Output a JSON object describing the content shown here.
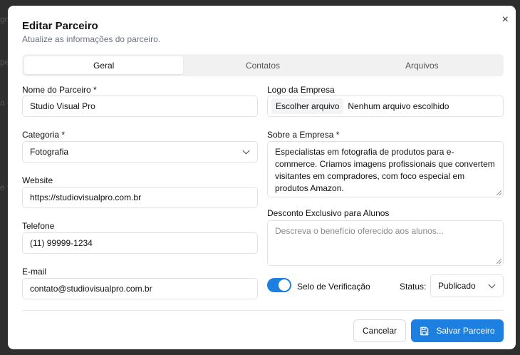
{
  "backdrop": {
    "fragments": [
      "gr",
      "pe",
      "a c",
      "e v"
    ]
  },
  "dialog": {
    "title": "Editar Parceiro",
    "subtitle": "Atualize as informações do parceiro.",
    "close_glyph": "×"
  },
  "tabs": [
    {
      "label": "Geral",
      "active": true
    },
    {
      "label": "Contatos",
      "active": false
    },
    {
      "label": "Arquivos",
      "active": false
    }
  ],
  "form": {
    "name": {
      "label": "Nome do Parceiro *",
      "value": "Studio Visual Pro"
    },
    "category": {
      "label": "Categoria *",
      "value": "Fotografia"
    },
    "website": {
      "label": "Website",
      "value": "https://studiovisualpro.com.br"
    },
    "phone": {
      "label": "Telefone",
      "value": "(11) 99999-1234"
    },
    "email": {
      "label": "E-mail",
      "value": "contato@studiovisualpro.com.br"
    },
    "logo": {
      "label": "Logo da Empresa",
      "button": "Escolher arquivo",
      "status": "Nenhum arquivo escolhido"
    },
    "about": {
      "label": "Sobre a Empresa *",
      "value": "Especialistas em fotografia de produtos para e-commerce. Criamos imagens profissionais que convertem visitantes em compradores, com foco especial em produtos Amazon."
    },
    "discount": {
      "label": "Desconto Exclusivo para Alunos",
      "placeholder": "Descreva o benefício oferecido aos alunos..."
    },
    "verification": {
      "label": "Selo de Verificação",
      "on": true
    },
    "status": {
      "label": "Status:",
      "value": "Publicado"
    }
  },
  "actions": {
    "cancel": "Cancelar",
    "save": "Salvar Parceiro"
  },
  "colors": {
    "accent": "#1d7fdf",
    "border": "#e2e2e5",
    "muted": "#6b7280"
  },
  "icons": {
    "close": "close-icon",
    "chevron": "chevron-down-icon",
    "save": "save-icon"
  }
}
